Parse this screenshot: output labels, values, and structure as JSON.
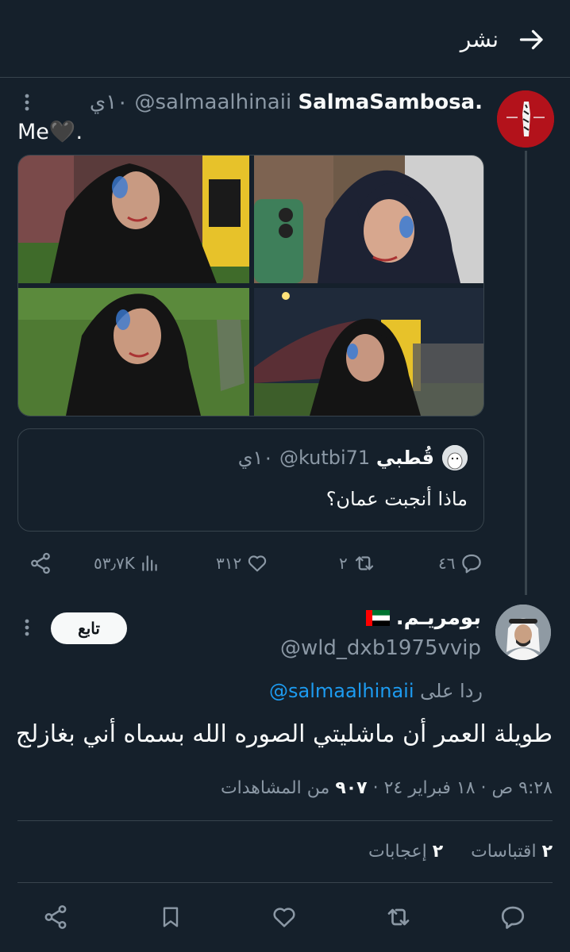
{
  "header": {
    "title": "نشر"
  },
  "parent_tweet": {
    "author_name": "SalmaSambosa.",
    "author_handle": "@salmaalhinaii",
    "time": "١٠ي",
    "text": "Me🖤.",
    "quoted": {
      "name": "قُطبي",
      "handle": "@kutbi71",
      "time": "١٠ي",
      "text": "ماذا أنجبت عمان؟"
    },
    "actions": {
      "replies": "٤٦",
      "retweets": "٢",
      "likes": "٣١٢",
      "views": "٥٣٫٧K"
    }
  },
  "reply_tweet": {
    "author_name": "بومريـم.",
    "author_handle": "@wld_dxb1975vvip",
    "follow_label": "تابع",
    "replying_to_prefix": "ردا على",
    "replying_to_handle": "@salmaalhinaii",
    "text": "طويلة العمر أن ماشليتي الصوره الله بسماه أني بغازلج",
    "timestamp": "٩:٢٨ ص · ١٨ فبراير ٢٤ ·",
    "views_count": "٩٠٧",
    "views_label": "من المشاهدات",
    "quotes_count": "٢",
    "quotes_label": "اقتباسات",
    "likes_count": "٢",
    "likes_label": "إعجابات"
  },
  "colors": {
    "background": "#15202b",
    "accent": "#1d9bf0",
    "muted": "#8b98a5",
    "border": "#38444d"
  },
  "icons": [
    "arrow-right-icon",
    "more-vertical-icon",
    "reply-icon",
    "retweet-icon",
    "like-icon",
    "views-icon",
    "share-icon",
    "bookmark-icon"
  ]
}
